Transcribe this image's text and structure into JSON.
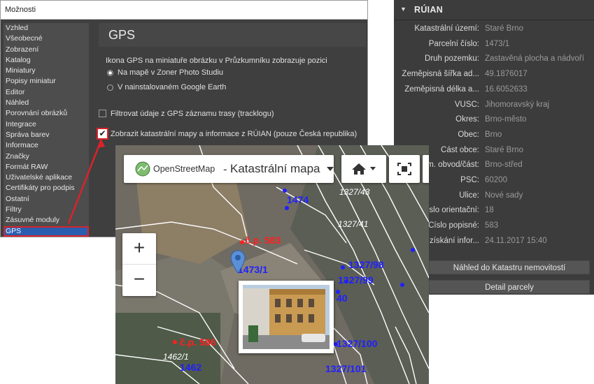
{
  "options": {
    "title": "Možnosti",
    "categories": [
      "Vzhled",
      "Všeobecné",
      "Zobrazení",
      "Katalog",
      "Miniatury",
      "Popisy miniatur",
      "Editor",
      "Náhled",
      "Porovnání obrázků",
      "Integrace",
      "Správa barev",
      "Informace",
      "Značky",
      "Formát RAW",
      "Uživatelské aplikace",
      "Certifikáty pro podpis",
      "Ostatní",
      "Filtry",
      "Zásuvné moduly",
      "GPS"
    ],
    "selected_category": "GPS",
    "gps": {
      "heading": "GPS",
      "icon_group_label": "Ikona GPS na miniatuře obrázku v Průzkumníku zobrazuje pozici",
      "radio_zoner": "Na mapě v Zoner Photo Studiu",
      "radio_google": "V nainstalovaném Google Earth",
      "filter_label": "Filtrovat údaje z GPS záznamu trasy (tracklogu)",
      "ruian_label": "Zobrazit katastrální mapy a informace z RÚIAN (pouze Česká republika)",
      "ruian_checked": true
    }
  },
  "ruian": {
    "title": "RÚIAN",
    "fields": [
      {
        "label": "Katastrální území:",
        "value": "Staré Brno"
      },
      {
        "label": "Parcelní číslo:",
        "value": "1473/1"
      },
      {
        "label": "Druh pozemku:",
        "value": "Zastavěná plocha a nádvoří"
      },
      {
        "label": "Zeměpisná šířka ad...",
        "value": "49.1876017"
      },
      {
        "label": "Zeměpisná délka a...",
        "value": "16.6052633"
      },
      {
        "label": "VÚSC:",
        "value": "Jihomoravský kraj"
      },
      {
        "label": "Okres:",
        "value": "Brno-město"
      },
      {
        "label": "Obec:",
        "value": "Brno"
      },
      {
        "label": "Část obce:",
        "value": "Staré Brno"
      },
      {
        "label": "Mom. obvod/část:",
        "value": "Brno-střed"
      },
      {
        "label": "PSČ:",
        "value": "60200"
      },
      {
        "label": "Ulice:",
        "value": "Nové sady"
      },
      {
        "label": "Číslo orientační:",
        "value": "18"
      },
      {
        "label": "Číslo popisné:",
        "value": "583"
      },
      {
        "label": "Datum získání infor...",
        "value": "24.11.2017 15:40"
      }
    ],
    "button_cadastre": "Náhled do Katastru nemovitostí",
    "button_parcel": "Detail parcely"
  },
  "map": {
    "provider": "OpenStreetMap",
    "separator": "-",
    "map_type": "Katastrální mapa",
    "zoom_in": "+",
    "zoom_out": "−",
    "labels_blue": [
      "1474",
      "1473/1",
      "1327/98",
      "1327/99",
      "1327/100",
      "1327/101",
      "1462",
      "40",
      "1327/43",
      "1327/41"
    ],
    "labels_red": [
      "č.p. 583",
      "č.p. 586",
      "č.p."
    ],
    "labels_white": [
      "1474",
      "1473/1",
      "1327/43",
      "1327/41",
      "1462/1"
    ]
  }
}
